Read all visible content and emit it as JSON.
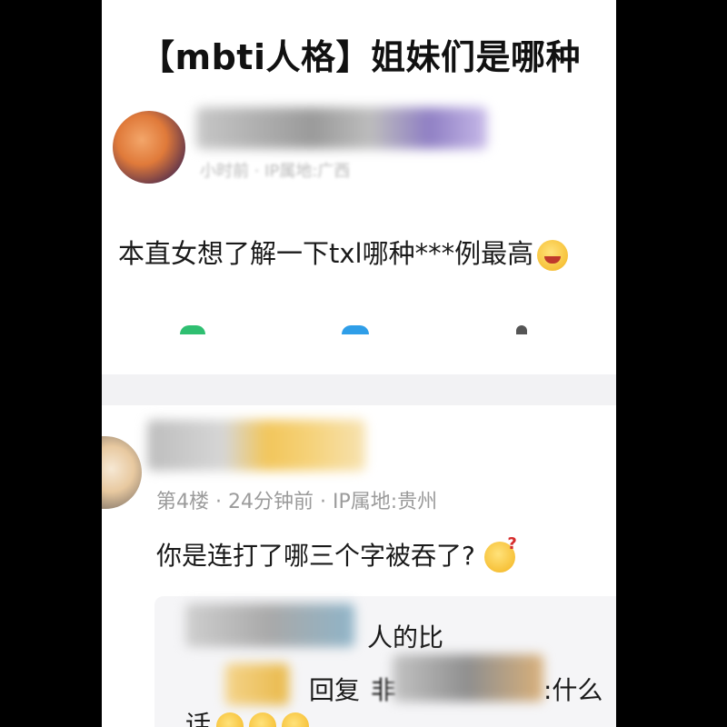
{
  "post": {
    "title": "【mbti人格】姐妹们是哪种",
    "author_meta": "小时前 · IP属地:广西",
    "body": "本直女想了解一下txl哪种***例最高"
  },
  "reply": {
    "meta": "第4楼 · 24分钟前 · IP属地:贵州",
    "body": "你是连打了哪三个字被吞了?",
    "sub_replies": {
      "line1": "人的比",
      "line2_prefix": "回复",
      "line2_partial": "非",
      "line2_suffix": ":什么",
      "line3": "话"
    }
  },
  "colors": {
    "dot_green": "#2fbf71",
    "dot_blue": "#2f9ee8",
    "dot_gray": "#555555"
  },
  "icons": [
    "fox-avatar-icon",
    "grin-emoji-icon",
    "thinking-emoji-icon",
    "laugh-emoji-icon"
  ]
}
